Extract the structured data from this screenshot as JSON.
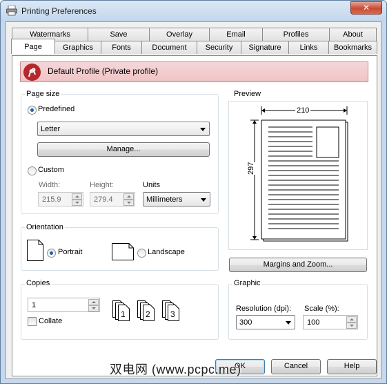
{
  "window": {
    "title": "Printing Preferences",
    "close_glyph": "✕"
  },
  "tabs": {
    "row1": [
      "Watermarks",
      "Save",
      "Overlay",
      "Email",
      "Profiles",
      "About"
    ],
    "row2": [
      "Page",
      "Graphics",
      "Fonts",
      "Document",
      "Security",
      "Signature",
      "Links",
      "Bookmarks"
    ],
    "active": "Page"
  },
  "profile": {
    "label": "Default Profile (Private profile)",
    "icon": "pdf-logo-icon"
  },
  "page_size": {
    "group_label": "Page size",
    "predefined_label": "Predefined",
    "predefined_selected": true,
    "paper_value": "Letter",
    "manage_label": "Manage...",
    "custom_label": "Custom",
    "width_label": "Width:",
    "width_value": "215.9",
    "height_label": "Height:",
    "height_value": "279.4",
    "units_label": "Units",
    "units_value": "Millimeters"
  },
  "orientation": {
    "group_label": "Orientation",
    "portrait_label": "Portrait",
    "landscape_label": "Landscape",
    "selected": "Portrait"
  },
  "copies": {
    "group_label": "Copies",
    "value": "1",
    "collate_label": "Collate",
    "collate_checked": false,
    "collate_digits": [
      "1",
      "2",
      "3"
    ]
  },
  "preview": {
    "group_label": "Preview",
    "width_dim": "210",
    "height_dim": "297",
    "margins_button": "Margins and Zoom..."
  },
  "graphic": {
    "group_label": "Graphic",
    "resolution_label": "Resolution (dpi):",
    "resolution_value": "300",
    "scale_label": "Scale (%):",
    "scale_value": "100"
  },
  "footer": {
    "ok": "OK",
    "cancel": "Cancel",
    "help": "Help"
  },
  "watermark_text": "双电网 (www.pcpc.me)",
  "colors": {
    "accent": "#1f5fa8",
    "profile_bg": "#f2ccce",
    "brand_red": "#b5282b"
  }
}
